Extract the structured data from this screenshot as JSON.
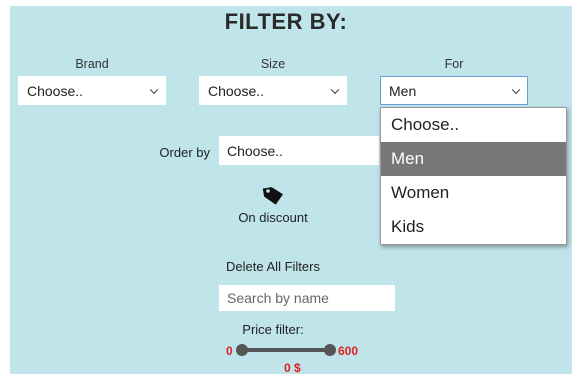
{
  "header": {
    "title": "FILTER BY:"
  },
  "filters": {
    "brand": {
      "label": "Brand",
      "value": "Choose.."
    },
    "size": {
      "label": "Size",
      "value": "Choose.."
    },
    "for": {
      "label": "For",
      "value": "Men"
    }
  },
  "for_dropdown": {
    "options": [
      "Choose..",
      "Men",
      "Women",
      "Kids"
    ],
    "selected": "Men"
  },
  "order": {
    "label": "Order by",
    "value": "Choose.."
  },
  "discount": {
    "icon": "tag-icon",
    "label": "On discount"
  },
  "delete_all": {
    "label": "Delete All Filters"
  },
  "search": {
    "placeholder": "Search by name"
  },
  "price": {
    "label": "Price filter:",
    "min_label": "0",
    "max_label": "600",
    "value_text": "0 $",
    "thumb_values": [
      0,
      600
    ],
    "range": [
      0,
      600
    ]
  },
  "colors": {
    "panel": "#bfe4ea",
    "accent_red": "#e0211f",
    "selected_option": "#777777"
  }
}
